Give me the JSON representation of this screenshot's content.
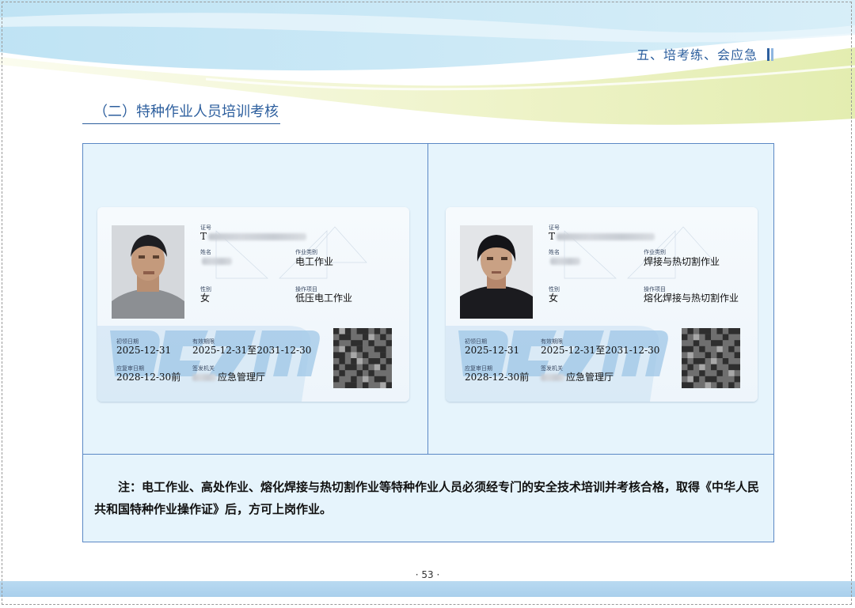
{
  "header": {
    "section_title": "五、培考练、会应急"
  },
  "subtitle": "（二）特种作业人员培训考核",
  "cards": [
    {
      "labels": {
        "id": "证号",
        "name": "姓名",
        "job_category": "作业类别",
        "gender": "性别",
        "operation_item": "操作项目",
        "first_issue": "初领日期",
        "validity": "有效期限",
        "review_date": "应复审日期",
        "issuer": "签发机关"
      },
      "id_prefix": "T",
      "job_category": "电工作业",
      "gender": "女",
      "operation_item": "低压电工作业",
      "first_issue": "2025-12-31",
      "validity": "2025-12-31至2031-12-30",
      "review_date": "2028-12-30前",
      "issuer_suffix": "应急管理厅"
    },
    {
      "labels": {
        "id": "证号",
        "name": "姓名",
        "job_category": "作业类别",
        "gender": "性别",
        "operation_item": "操作项目",
        "first_issue": "初领日期",
        "validity": "有效期限",
        "review_date": "应复审日期",
        "issuer": "签发机关"
      },
      "id_prefix": "T",
      "job_category": "焊接与热切割作业",
      "gender": "女",
      "operation_item": "熔化焊接与热切割作业",
      "first_issue": "2025-12-31",
      "validity": "2025-12-31至2031-12-30",
      "review_date": "2028-12-30前",
      "issuer_suffix": "应急管理厅"
    }
  ],
  "note": "注：电工作业、高处作业、熔化焊接与热切割作业等特种作业人员必须经专门的安全技术培训并考核合格，取得《中华人民共和国特种作业操作证》后，方可上岗作业。",
  "page_number": "· 53 ·",
  "colors": {
    "accent": "#2d5f9e",
    "table_border": "#5b88c5",
    "table_fill": "#e6f4fc"
  }
}
